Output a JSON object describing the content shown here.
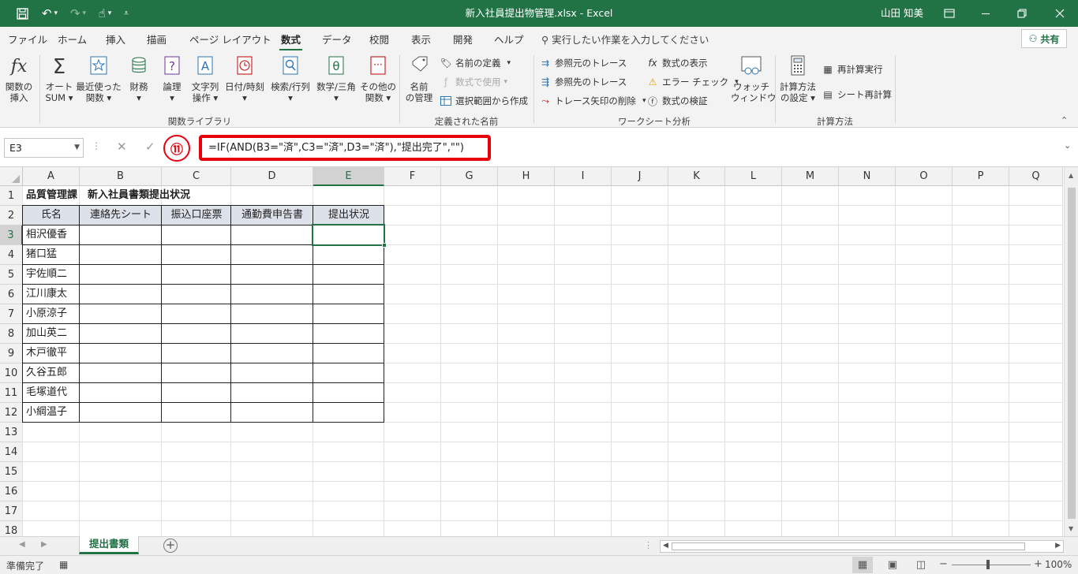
{
  "titlebar": {
    "title": "新入社員提出物管理.xlsx  -  Excel",
    "user": "山田 知美",
    "bg": "#217346"
  },
  "tabs": [
    "ファイル",
    "ホーム",
    "挿入",
    "描画",
    "ページ レイアウト",
    "数式",
    "データ",
    "校閲",
    "表示",
    "開発",
    "ヘルプ"
  ],
  "active_tab": "数式",
  "tell_me": "実行したい作業を入力してください",
  "share": "共有",
  "ribbon": {
    "function_library": {
      "label": "関数ライブラリ",
      "insert_fn": "関数の\n挿入",
      "autosum": "オート\nSUM ▾",
      "recent": "最近使った\n関数 ▾",
      "financial": "財務\n▾",
      "logical": "論理\n▾",
      "text": "文字列\n操作 ▾",
      "datetime": "日付/時刻\n▾",
      "lookup": "検索/行列\n▾",
      "math": "数学/三角\n▾",
      "more": "その他の\n関数 ▾"
    },
    "defined_names": {
      "label": "定義された名前",
      "name_manager": "名前\nの管理",
      "define_name": "名前の定義",
      "use_in_formula": "数式で使用",
      "create_from_selection": "選択範囲から作成"
    },
    "formula_auditing": {
      "label": "ワークシート分析",
      "trace_precedents": "参照元のトレース",
      "trace_dependents": "参照先のトレース",
      "remove_arrows": "トレース矢印の削除",
      "show_formulas": "数式の表示",
      "error_checking": "エラー チェック",
      "evaluate": "数式の検証",
      "watch": "ウォッチ\nウィンドウ"
    },
    "calculation": {
      "label": "計算方法",
      "options": "計算方法\nの設定 ▾",
      "calc_now": "再計算実行",
      "calc_sheet": "シート再計算"
    }
  },
  "formula_bar": {
    "name_box": "E3",
    "formula": "=IF(AND(B3=\"済\",C3=\"済\",D3=\"済\"),\"提出完了\",\"\")",
    "callout": "⑪"
  },
  "columns": [
    "A",
    "B",
    "C",
    "D",
    "E",
    "F",
    "G",
    "H",
    "I",
    "J",
    "K",
    "L",
    "M",
    "N",
    "O",
    "P",
    "Q"
  ],
  "rows": [
    "1",
    "2",
    "3",
    "4",
    "5",
    "6",
    "7",
    "8",
    "9",
    "10",
    "11",
    "12",
    "13",
    "14",
    "15",
    "16",
    "17",
    "18"
  ],
  "selected_cell": "E3",
  "sheet": {
    "title": "品質管理課　新入社員書類提出状況",
    "headers": [
      "氏名",
      "連絡先シート",
      "振込口座票",
      "通勤費申告書",
      "提出状況"
    ],
    "names": [
      "相沢優香",
      "猪口猛",
      "宇佐順二",
      "江川康太",
      "小原涼子",
      "加山英二",
      "木戸徹平",
      "久谷五郎",
      "毛塚道代",
      "小綱温子"
    ]
  },
  "sheet_tabs": [
    "提出書類"
  ],
  "status": {
    "ready": "準備完了",
    "zoom": "100%"
  }
}
